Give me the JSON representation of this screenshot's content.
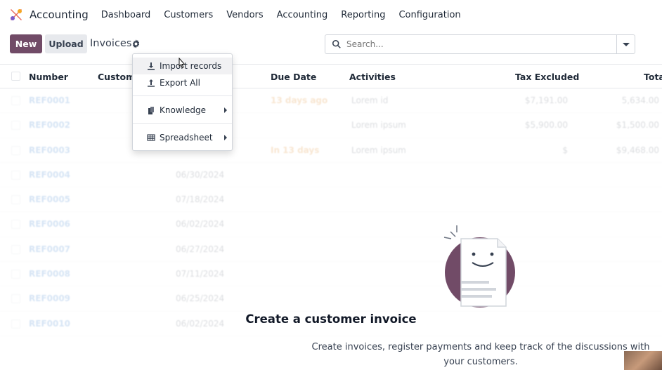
{
  "navbar": {
    "brand": "Accounting",
    "items": [
      "Dashboard",
      "Customers",
      "Vendors",
      "Accounting",
      "Reporting",
      "Configuration"
    ]
  },
  "control_panel": {
    "new_label": "New",
    "upload_label": "Upload",
    "breadcrumb": "Invoices",
    "search_placeholder": "Search..."
  },
  "table": {
    "columns": [
      "Number",
      "Customer",
      "Due Date",
      "Activities",
      "Tax Excluded",
      "Total"
    ],
    "rows": [
      {
        "number": "REF0001",
        "date": "",
        "due": "13 days ago",
        "activity": "Lorem id",
        "tax": "$7,191.00",
        "total": "5,634.00"
      },
      {
        "number": "REF0002",
        "date": "",
        "due": "",
        "activity": "Lorem ipsum",
        "tax": "$5,900.00",
        "total": "$1,500.00"
      },
      {
        "number": "REF0003",
        "date": "",
        "due": "In 13 days",
        "activity": "Lorem ipsum",
        "tax": "$",
        "total": "$9,468.00"
      },
      {
        "number": "REF0004",
        "date": "06/30/2024",
        "due": "",
        "activity": "",
        "tax": "",
        "total": ""
      },
      {
        "number": "REF0005",
        "date": "07/18/2024",
        "due": "",
        "activity": "",
        "tax": "",
        "total": ""
      },
      {
        "number": "REF0006",
        "date": "06/02/2024",
        "due": "",
        "activity": "",
        "tax": "",
        "total": ""
      },
      {
        "number": "REF0007",
        "date": "06/27/2024",
        "due": "",
        "activity": "",
        "tax": "",
        "total": ""
      },
      {
        "number": "REF0008",
        "date": "07/11/2024",
        "due": "",
        "activity": "",
        "tax": "",
        "total": ""
      },
      {
        "number": "REF0009",
        "date": "06/25/2024",
        "due": "",
        "activity": "",
        "tax": "",
        "total": ""
      },
      {
        "number": "REF0010",
        "date": "06/02/2024",
        "due": "",
        "activity": "",
        "tax": "",
        "total": ""
      }
    ]
  },
  "dropdown": {
    "items": [
      {
        "label": "Import records",
        "icon": "download-icon"
      },
      {
        "label": "Export All",
        "icon": "upload-icon"
      },
      {
        "label": "Knowledge",
        "icon": "bookmark-icon"
      },
      {
        "label": "Spreadsheet",
        "icon": "table-icon"
      }
    ]
  },
  "empty_state": {
    "title": "Create a customer invoice",
    "description": "Create invoices, register payments and keep track of the discussions with your customers."
  },
  "colors": {
    "brand": "#714B67",
    "link": "#1f6ec7"
  }
}
